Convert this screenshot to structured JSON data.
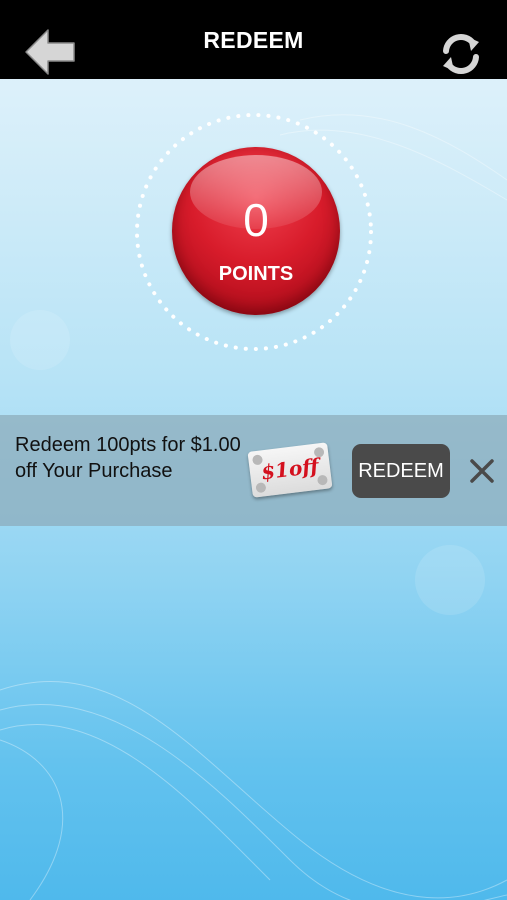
{
  "header": {
    "title": "REDEEM",
    "back_icon": "back-arrow-icon",
    "refresh_icon": "refresh-icon"
  },
  "points": {
    "value": "0",
    "label": "POINTS"
  },
  "rewards": [
    {
      "description": "Redeem 100pts for $1.00 off Your Purchase",
      "coupon_text": "$1off",
      "button_label": "REDEEM",
      "dismiss_icon": "close-icon"
    }
  ],
  "colors": {
    "header_bg": "#000000",
    "points_ball": "#d81c2b",
    "redeem_button": "#4a4a4a",
    "reward_row_bg": "#8caaba",
    "coupon_text": "#d4101e"
  }
}
